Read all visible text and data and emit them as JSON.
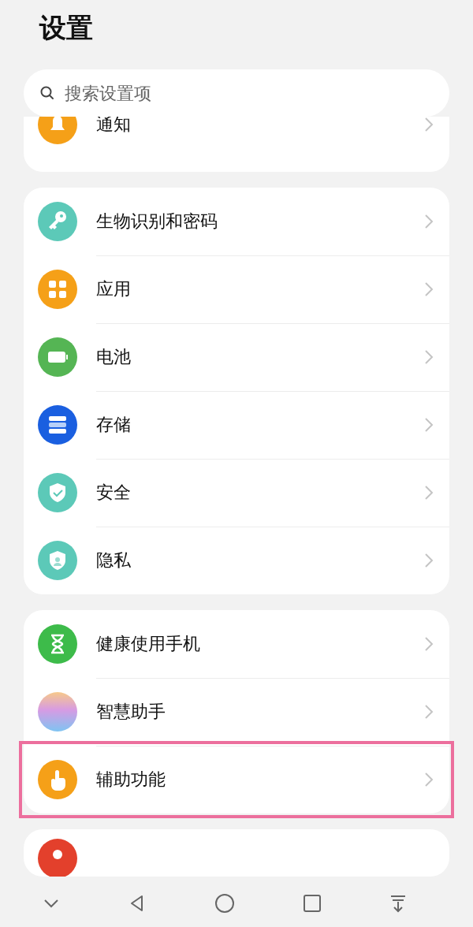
{
  "title": "设置",
  "search": {
    "placeholder": "搜索设置项"
  },
  "sections": [
    {
      "items": [
        {
          "label": "通知",
          "highlighted": false
        }
      ]
    },
    {
      "items": [
        {
          "label": "生物识别和密码",
          "highlighted": false
        },
        {
          "label": "应用",
          "highlighted": false
        },
        {
          "label": "电池",
          "highlighted": false
        },
        {
          "label": "存储",
          "highlighted": false
        },
        {
          "label": "安全",
          "highlighted": false
        },
        {
          "label": "隐私",
          "highlighted": false
        }
      ]
    },
    {
      "items": [
        {
          "label": "健康使用手机",
          "highlighted": false
        },
        {
          "label": "智慧助手",
          "highlighted": false
        },
        {
          "label": "辅助功能",
          "highlighted": true
        }
      ]
    }
  ]
}
